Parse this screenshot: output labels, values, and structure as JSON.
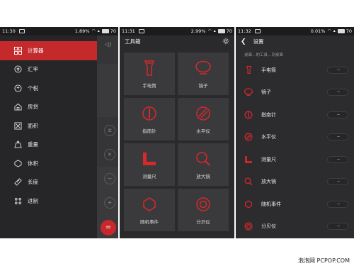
{
  "screens": [
    {
      "status": {
        "time": "11:30",
        "battery_pct": "1.89%",
        "battery_level": "70"
      },
      "drawer": {
        "items": [
          {
            "label": "计算器",
            "icon": "calculator-icon",
            "active": true
          },
          {
            "label": "汇率",
            "icon": "exchange-rate-icon"
          },
          {
            "label": "个税",
            "icon": "income-tax-icon"
          },
          {
            "label": "房贷",
            "icon": "mortgage-icon"
          },
          {
            "label": "面积",
            "icon": "area-icon"
          },
          {
            "label": "重量",
            "icon": "weight-icon"
          },
          {
            "label": "体积",
            "icon": "volume-icon"
          },
          {
            "label": "长度",
            "icon": "length-icon"
          },
          {
            "label": "进制",
            "icon": "base-conversion-icon"
          }
        ]
      },
      "background_app": {
        "fab_label": "="
      }
    },
    {
      "status": {
        "time": "11:31",
        "battery_pct": "2.99%",
        "battery_level": "70"
      },
      "title": "工具箱",
      "tools": [
        {
          "label": "手电筒",
          "icon": "flashlight-icon"
        },
        {
          "label": "镜子",
          "icon": "mirror-icon"
        },
        {
          "label": "指南针",
          "icon": "compass-icon"
        },
        {
          "label": "水平仪",
          "icon": "level-icon"
        },
        {
          "label": "测量尺",
          "icon": "ruler-icon"
        },
        {
          "label": "放大镜",
          "icon": "magnifier-icon"
        },
        {
          "label": "随机事件",
          "icon": "dice-icon"
        },
        {
          "label": "分贝仪",
          "icon": "decibel-meter-icon"
        }
      ]
    },
    {
      "status": {
        "time": "11:32",
        "battery_pct": "0.01%",
        "battery_level": "70"
      },
      "title": "设置",
      "hint": "桌面…的工具…到桌面",
      "rows": [
        {
          "label": "手电筒",
          "icon": "flashlight-icon"
        },
        {
          "label": "镜子",
          "icon": "mirror-icon"
        },
        {
          "label": "指南针",
          "icon": "compass-icon"
        },
        {
          "label": "水平仪",
          "icon": "level-icon"
        },
        {
          "label": "测量尺",
          "icon": "ruler-icon"
        },
        {
          "label": "放大镜",
          "icon": "magnifier-icon"
        },
        {
          "label": "随机事件",
          "icon": "dice-icon"
        },
        {
          "label": "分贝仪",
          "icon": "decibel-meter-icon"
        }
      ]
    }
  ],
  "watermark": "泡泡网 PCPOP.COM",
  "colors": {
    "accent": "#c42a2c",
    "panel": "#2a2a2c",
    "tile": "#3a3a3c"
  }
}
